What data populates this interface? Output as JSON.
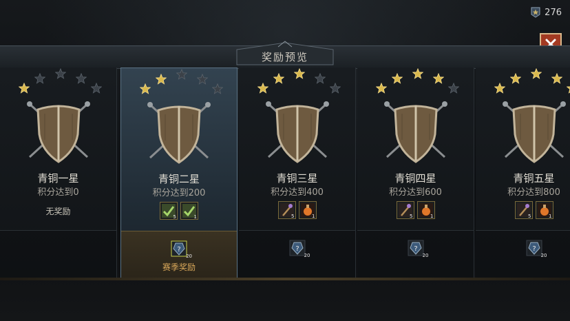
{
  "window_title": "奖励预览",
  "currency": {
    "icon": "star-badge-icon",
    "value": "276"
  },
  "close_icon": "close-icon",
  "cards": [
    {
      "name": "青铜一星",
      "requirement": "积分达到0",
      "stars_filled": 1,
      "no_reward": "无奖励",
      "items": [],
      "season_count": ""
    },
    {
      "name": "青铜二星",
      "requirement": "积分达到200",
      "stars_filled": 2,
      "selected": true,
      "items": [
        {
          "icon": "check-scroll-icon",
          "count": "5"
        },
        {
          "icon": "check-scroll-icon",
          "count": "1"
        }
      ],
      "season_count": "20",
      "season_label": "赛季奖励"
    },
    {
      "name": "青铜三星",
      "requirement": "积分达到400",
      "stars_filled": 3,
      "items": [
        {
          "icon": "staff-icon",
          "count": "5"
        },
        {
          "icon": "potion-icon",
          "count": "1"
        }
      ],
      "season_count": "20"
    },
    {
      "name": "青铜四星",
      "requirement": "积分达到600",
      "stars_filled": 4,
      "items": [
        {
          "icon": "staff-icon",
          "count": "5"
        },
        {
          "icon": "potion-icon",
          "count": "1"
        }
      ],
      "season_count": "20"
    },
    {
      "name": "青铜五星",
      "requirement": "积分达到800",
      "stars_filled": 5,
      "items": [
        {
          "icon": "staff-icon",
          "count": "5"
        },
        {
          "icon": "potion-icon",
          "count": "1"
        }
      ],
      "season_count": "20"
    }
  ]
}
